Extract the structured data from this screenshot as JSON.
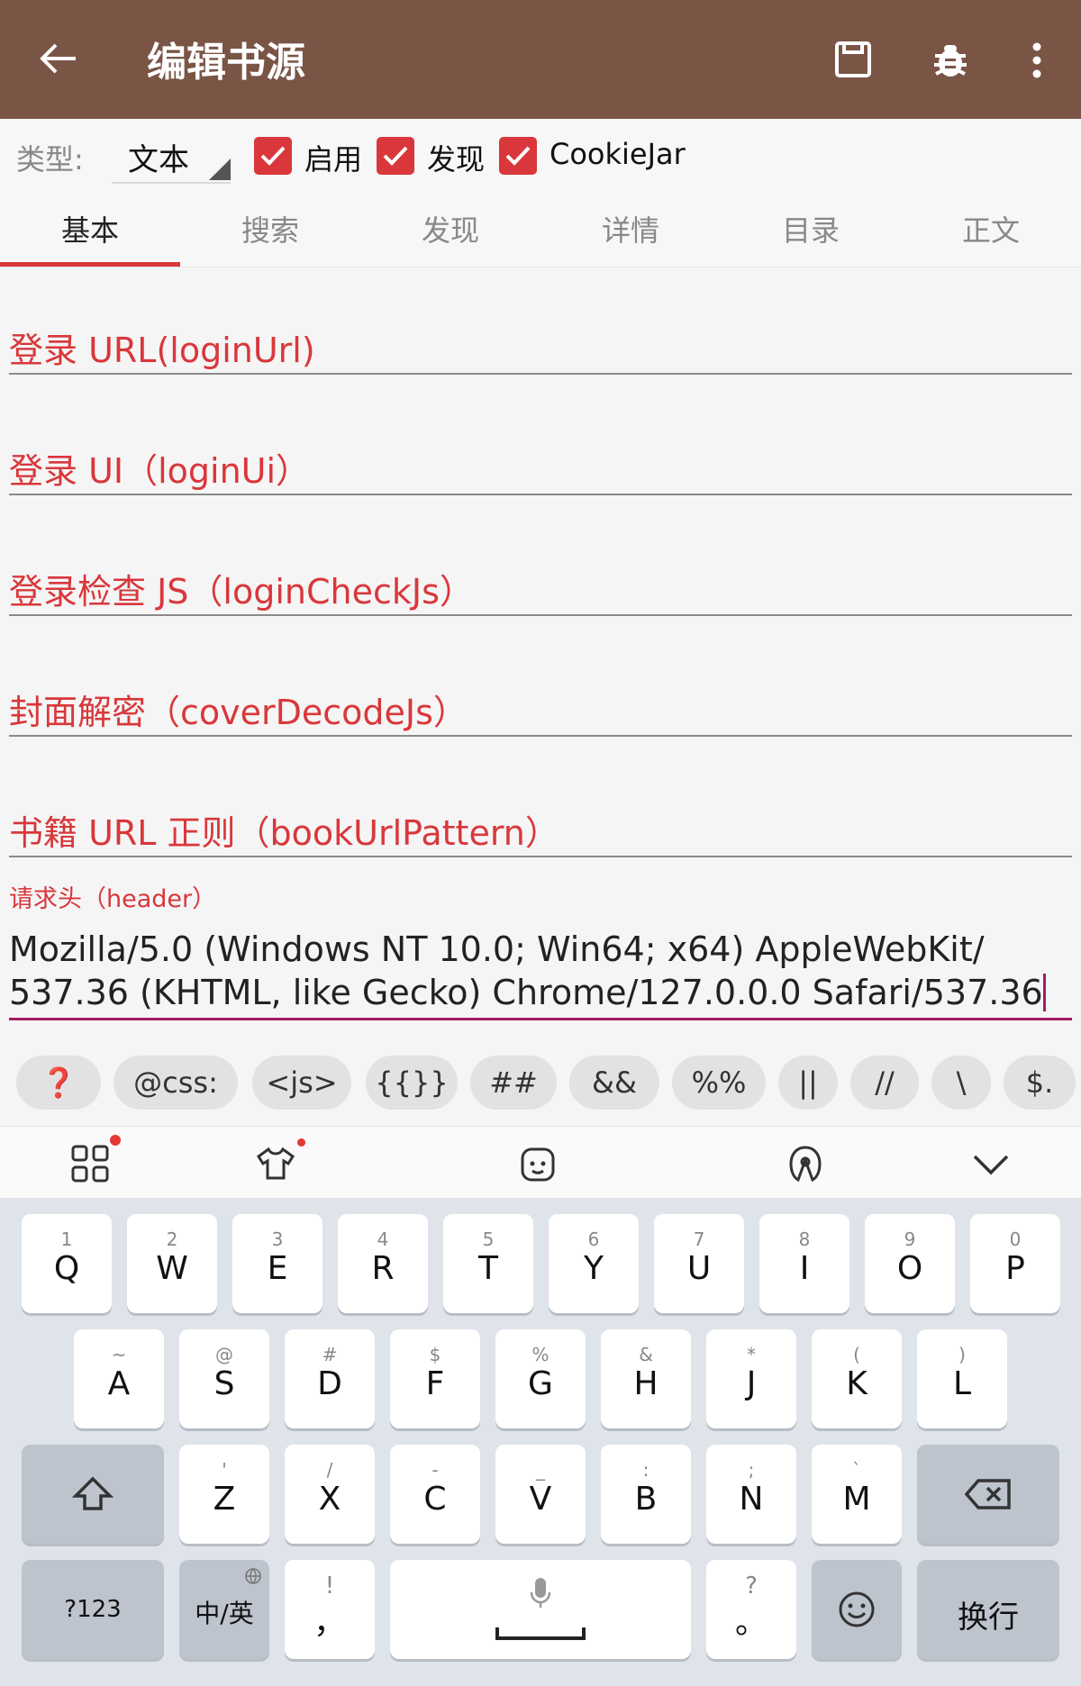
{
  "appbar": {
    "title": "编辑书源"
  },
  "type_row": {
    "label": "类型:",
    "selected": "文本",
    "checks": [
      {
        "label": "启用",
        "checked": true
      },
      {
        "label": "发现",
        "checked": true
      },
      {
        "label": "CookieJar",
        "checked": true
      }
    ]
  },
  "tabs": [
    "基本",
    "搜索",
    "发现",
    "详情",
    "目录",
    "正文"
  ],
  "fields": [
    {
      "label": "登录 URL(loginUrl)"
    },
    {
      "label": "登录 UI（loginUi）"
    },
    {
      "label": "登录检查 JS（loginCheckJs）"
    },
    {
      "label": "封面解密（coverDecodeJs）"
    },
    {
      "label": "书籍 URL 正则（bookUrlPattern）"
    }
  ],
  "header_field": {
    "label": "请求头（header）",
    "line1": "Mozilla/5.0 (Windows NT 10.0; Win64; x64) AppleWebKit/",
    "line2": "537.36 (KHTML, like Gecko) Chrome/127.0.0.0 Safari/537.36"
  },
  "chips": [
    "❓",
    "@css:",
    "<js>",
    "{{}}",
    "##",
    "&&",
    "%%",
    "||",
    "//",
    "\\",
    "$."
  ],
  "keyboard": {
    "row1": [
      {
        "sup": "1",
        "main": "Q"
      },
      {
        "sup": "2",
        "main": "W"
      },
      {
        "sup": "3",
        "main": "E"
      },
      {
        "sup": "4",
        "main": "R"
      },
      {
        "sup": "5",
        "main": "T"
      },
      {
        "sup": "6",
        "main": "Y"
      },
      {
        "sup": "7",
        "main": "U"
      },
      {
        "sup": "8",
        "main": "I"
      },
      {
        "sup": "9",
        "main": "O"
      },
      {
        "sup": "0",
        "main": "P"
      }
    ],
    "row2": [
      {
        "sup": "~",
        "main": "A"
      },
      {
        "sup": "@",
        "main": "S"
      },
      {
        "sup": "#",
        "main": "D"
      },
      {
        "sup": "$",
        "main": "F"
      },
      {
        "sup": "%",
        "main": "G"
      },
      {
        "sup": "&",
        "main": "H"
      },
      {
        "sup": "*",
        "main": "J"
      },
      {
        "sup": "(",
        "main": "K"
      },
      {
        "sup": ")",
        "main": "L"
      }
    ],
    "row3": [
      {
        "sup": "'",
        "main": "Z"
      },
      {
        "sup": "/",
        "main": "X"
      },
      {
        "sup": "-",
        "main": "C"
      },
      {
        "sup": "_",
        "main": "V"
      },
      {
        "sup": ":",
        "main": "B"
      },
      {
        "sup": ";",
        "main": "N"
      },
      {
        "sup": "`",
        "main": "M"
      }
    ],
    "sym_label": "?123",
    "lang_label": "中/英",
    "comma_sup": "!",
    "comma_main": "，",
    "period_sup": "?",
    "period_main": "。",
    "enter_label": "换行"
  }
}
